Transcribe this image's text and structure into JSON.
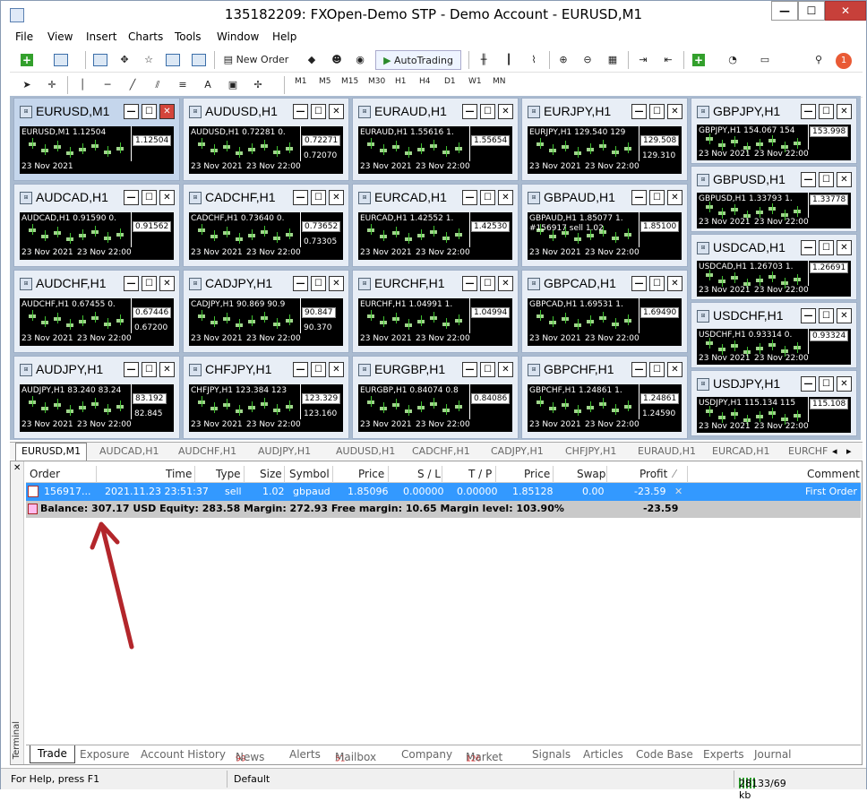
{
  "window": {
    "title": "135182209: FXOpen-Demo STP - Demo Account - EURUSD,M1",
    "minimize": "—",
    "maximize": "☐",
    "close": "✕"
  },
  "menu": [
    "File",
    "View",
    "Insert",
    "Charts",
    "Tools",
    "Window",
    "Help"
  ],
  "toolbar": {
    "new_order": "New Order",
    "autotrading": "AutoTrading",
    "timeframes": [
      "M1",
      "M5",
      "M15",
      "M30",
      "H1",
      "H4",
      "D1",
      "W1",
      "MN"
    ],
    "notification_count": "1"
  },
  "charts": [
    {
      "title": "EURUSD,M1",
      "symbol_line": "EURUSD,M1 1.12504",
      "price": "1.12504",
      "price2": "",
      "date1": "23 Nov 2021",
      "date2": ""
    },
    {
      "title": "AUDUSD,H1",
      "symbol_line": "AUDUSD,H1 0.72281 0.",
      "price": "0.72271",
      "price2": "0.72070",
      "date1": "23 Nov 2021",
      "date2": "23 Nov 22:00"
    },
    {
      "title": "EURAUD,H1",
      "symbol_line": "EURAUD,H1 1.55616 1.",
      "price": "1.55654",
      "price2": "",
      "date1": "23 Nov 2021",
      "date2": "23 Nov 22:00"
    },
    {
      "title": "EURJPY,H1",
      "symbol_line": "EURJPY,H1 129.540 129",
      "price": "129.508",
      "price2": "129.310",
      "date1": "23 Nov 2021",
      "date2": "23 Nov 22:00"
    },
    {
      "title": "GBPJPY,H1",
      "symbol_line": "GBPJPY,H1 154.067 154",
      "price": "153.998",
      "price2": "",
      "date1": "23 Nov 2021",
      "date2": "23 Nov 22:00"
    },
    {
      "title": "AUDCAD,H1",
      "symbol_line": "AUDCAD,H1 0.91590 0.",
      "price": "0.91562",
      "price2": "",
      "date1": "23 Nov 2021",
      "date2": "23 Nov 22:00"
    },
    {
      "title": "CADCHF,H1",
      "symbol_line": "CADCHF,H1 0.73640 0.",
      "price": "0.73652",
      "price2": "0.73305",
      "date1": "23 Nov 2021",
      "date2": "23 Nov 22:00"
    },
    {
      "title": "EURCAD,H1",
      "symbol_line": "EURCAD,H1 1.42552 1.",
      "price": "1.42530",
      "price2": "",
      "date1": "23 Nov 2021",
      "date2": "23 Nov 22:00"
    },
    {
      "title": "GBPAUD,H1",
      "symbol_line": "GBPAUD,H1 1.85077 1.",
      "price": "1.85100",
      "price2": "",
      "date1": "23 Nov 2021",
      "date2": "23 Nov 22:00",
      "extra": "#156917 sell 1.02"
    },
    {
      "title": "GBPUSD,H1",
      "symbol_line": "GBPUSD,H1 1.33793 1.",
      "price": "1.33778",
      "price2": "",
      "date1": "23 Nov 2021",
      "date2": "23 Nov 22:00"
    },
    {
      "title": "AUDCHF,H1",
      "symbol_line": "AUDCHF,H1 0.67455 0.",
      "price": "0.67446",
      "price2": "0.67200",
      "date1": "23 Nov 2021",
      "date2": "23 Nov 22:00"
    },
    {
      "title": "CADJPY,H1",
      "symbol_line": "CADJPY,H1 90.869 90.9",
      "price": "90.847",
      "price2": "90.370",
      "date1": "23 Nov 2021",
      "date2": "23 Nov 22:00"
    },
    {
      "title": "EURCHF,H1",
      "symbol_line": "EURCHF,H1 1.04991 1.",
      "price": "1.04994",
      "price2": "",
      "date1": "23 Nov 2021",
      "date2": "23 Nov 22:00"
    },
    {
      "title": "GBPCAD,H1",
      "symbol_line": "GBPCAD,H1 1.69531 1.",
      "price": "1.69490",
      "price2": "",
      "date1": "23 Nov 2021",
      "date2": "23 Nov 22:00"
    },
    {
      "title": "USDCAD,H1",
      "symbol_line": "USDCAD,H1 1.26703 1.",
      "price": "1.26691",
      "price2": "",
      "date1": "23 Nov 2021",
      "date2": "23 Nov 22:00"
    },
    {
      "title": "AUDJPY,H1",
      "symbol_line": "AUDJPY,H1 83.240 83.24",
      "price": "83.192",
      "price2": "82.845",
      "date1": "23 Nov 2021",
      "date2": "23 Nov 22:00"
    },
    {
      "title": "CHFJPY,H1",
      "symbol_line": "CHFJPY,H1 123.384 123",
      "price": "123.329",
      "price2": "123.160",
      "date1": "23 Nov 2021",
      "date2": "23 Nov 22:00"
    },
    {
      "title": "EURGBP,H1",
      "symbol_line": "EURGBP,H1 0.84074 0.8",
      "price": "0.84086",
      "price2": "",
      "date1": "23 Nov 2021",
      "date2": "23 Nov 22:00"
    },
    {
      "title": "GBPCHF,H1",
      "symbol_line": "GBPCHF,H1 1.24861 1.",
      "price": "1.24861",
      "price2": "1.24590",
      "date1": "23 Nov 2021",
      "date2": "23 Nov 22:00"
    },
    {
      "title": "USDCHF,H1",
      "symbol_line": "USDCHF,H1 0.93314 0.",
      "price": "0.93324",
      "price2": "",
      "date1": "23 Nov 2021",
      "date2": "23 Nov 22:00"
    },
    {
      "title": "USDJPY,H1",
      "symbol_line": "USDJPY,H1 115.134 115",
      "price": "115.108",
      "price2": "",
      "date1": "23 Nov 2021",
      "date2": "23 Nov 22:00"
    }
  ],
  "chart_tabs": [
    "EURUSD,M1",
    "AUDCAD,H1",
    "AUDCHF,H1",
    "AUDJPY,H1",
    "AUDUSD,H1",
    "CADCHF,H1",
    "CADJPY,H1",
    "CHFJPY,H1",
    "EURAUD,H1",
    "EURCAD,H1",
    "EURCHF"
  ],
  "terminal": {
    "label": "Terminal",
    "columns": [
      "Order",
      "Time",
      "Type",
      "Size",
      "Symbol",
      "Price",
      "S / L",
      "T / P",
      "Price",
      "Swap",
      "Profit",
      "Comment"
    ],
    "order": {
      "order": "156917...",
      "time": "2021.11.23 23:51:37",
      "type": "sell",
      "size": "1.02",
      "symbol": "gbpaud",
      "price": "1.85096",
      "sl": "0.00000",
      "tp": "0.00000",
      "cur_price": "1.85128",
      "swap": "0.00",
      "profit": "-23.59",
      "comment": "First Order"
    },
    "balance_line": "Balance: 307.17 USD  Equity: 283.58  Margin: 272.93  Free margin: 10.65  Margin level: 103.90%",
    "total_profit": "-23.59",
    "tabs": [
      {
        "label": "Trade",
        "badge": ""
      },
      {
        "label": "Exposure",
        "badge": ""
      },
      {
        "label": "Account History",
        "badge": ""
      },
      {
        "label": "News",
        "badge": "99"
      },
      {
        "label": "Alerts",
        "badge": ""
      },
      {
        "label": "Mailbox",
        "badge": "51"
      },
      {
        "label": "Company",
        "badge": ""
      },
      {
        "label": "Market",
        "badge": "126"
      },
      {
        "label": "Signals",
        "badge": ""
      },
      {
        "label": "Articles",
        "badge": ""
      },
      {
        "label": "Code Base",
        "badge": ""
      },
      {
        "label": "Experts",
        "badge": ""
      },
      {
        "label": "Journal",
        "badge": ""
      }
    ]
  },
  "status": {
    "help": "For Help, press F1",
    "profile": "Default",
    "traffic": "28133/69 kb"
  },
  "colors": {
    "selection": "#3399ff",
    "arrow": "#b3262b",
    "candle": "#9fd58b"
  }
}
